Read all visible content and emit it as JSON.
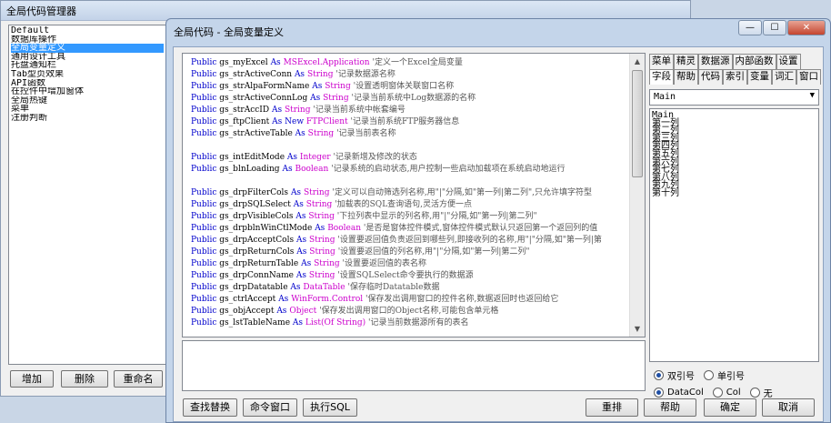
{
  "back_window": {
    "title": "全局代码管理器",
    "list_items": [
      "Default",
      "数据库操作",
      "全局变量定义",
      "通用设计工具",
      "托盘通知栏",
      "Tab型页效果",
      "API函数",
      "在控件中增加窗体",
      "全局热键",
      "菜单",
      "注册判断"
    ],
    "selected_item": "全局变量定义",
    "buttons": {
      "add": "增加",
      "delete": "删除",
      "rename": "重命名"
    }
  },
  "dialog": {
    "title": "全局代码 - 全局变量定义",
    "caption_buttons": {
      "minimize": "—",
      "maximize": "☐",
      "close": "✕"
    },
    "code_lines": [
      {
        "kw": "Public",
        "name": "gs_myExcel",
        "as": "As",
        "type": "MSExcel.Application",
        "comment": "'定义一个Excel全局变量"
      },
      {
        "kw": "Public",
        "name": "gs_strActiveConn",
        "as": "As",
        "type": "String",
        "comment": "'记录数据源名称"
      },
      {
        "kw": "Public",
        "name": "gs_strAlpaFormName",
        "as": "As",
        "type": "String",
        "comment": "'设置透明窗体关联窗口名称"
      },
      {
        "kw": "Public",
        "name": "gs_strActiveConnLog",
        "as": "As",
        "type": "String",
        "comment": "'记录当前系统中Log数据源的名称"
      },
      {
        "kw": "Public",
        "name": "gs_strAccID",
        "as": "As",
        "type": "String",
        "comment": "'记录当前系统中帐套编号"
      },
      {
        "kw": "Public",
        "name": "gs_ftpClient",
        "as": "As New",
        "type": "FTPClient",
        "comment": "'记录当前系统FTP服务器信息"
      },
      {
        "kw": "Public",
        "name": "gs_strActiveTable",
        "as": "As",
        "type": "String",
        "comment": "'记录当前表名称"
      },
      {
        "kw": "",
        "name": "",
        "as": "",
        "type": "",
        "comment": ""
      },
      {
        "kw": "Public",
        "name": "gs_intEditMode",
        "as": "As",
        "type": "Integer",
        "comment": "'记录新增及修改的状态"
      },
      {
        "kw": "Public",
        "name": "gs_blnLoading",
        "as": "As",
        "type": "Boolean",
        "comment": "'记录系统的启动状态,用户控制一些启动加载项在系统启动地运行"
      },
      {
        "kw": "",
        "name": "",
        "as": "",
        "type": "",
        "comment": ""
      },
      {
        "kw": "Public",
        "name": "gs_drpFilterCols",
        "as": "As",
        "type": "String",
        "comment": "'定义可以自动筛选列名称,用\"|\"分隔,如\"第一列|第二列\",只允许填字符型"
      },
      {
        "kw": "Public",
        "name": "gs_drpSQLSelect",
        "as": "As",
        "type": "String",
        "comment": "'加载表的SQL查询语句,灵活方便一点"
      },
      {
        "kw": "Public",
        "name": "gs_drpVisibleCols",
        "as": "As",
        "type": "String",
        "comment": "'下拉列表中显示的列名称,用\"|\"分隔,如\"第一列|第二列\""
      },
      {
        "kw": "Public",
        "name": "gs_drpblnWinCtlMode",
        "as": "As",
        "type": "Boolean",
        "comment": "'是否是窗体控件模式,窗体控件模式默认只返回第一个返回列的值"
      },
      {
        "kw": "Public",
        "name": "gs_drpAcceptCols",
        "as": "As",
        "type": "String",
        "comment": "'设置要返回值负责返回到哪些列,即接收列的名称,用\"|\"分隔,如\"第一列|第"
      },
      {
        "kw": "Public",
        "name": "gs_drpReturnCols",
        "as": "As",
        "type": "String",
        "comment": "'设置要返回值的列名称,用\"|\"分隔,如\"第一列|第二列\""
      },
      {
        "kw": "Public",
        "name": "gs_drpReturnTable",
        "as": "As",
        "type": "String",
        "comment": "'设置要返回值的表名称"
      },
      {
        "kw": "Public",
        "name": "gs_drpConnName",
        "as": "As",
        "type": "String",
        "comment": "'设置SQLSelect命令要执行的数据源"
      },
      {
        "kw": "Public",
        "name": "gs_drpDatatable",
        "as": "As",
        "type": "DataTable",
        "comment": "'保存临时Datatable数据"
      },
      {
        "kw": "Public",
        "name": "gs_ctrlAccept",
        "as": "As",
        "type": "WinForm.Control",
        "comment": "'保存发出调用窗口的控件名称,数据返回时也返回给它"
      },
      {
        "kw": "Public",
        "name": "gs_objAccept",
        "as": "As",
        "type": "Object",
        "comment": "'保存发出调用窗口的Object名称,可能包含单元格"
      },
      {
        "kw": "Public",
        "name": "gs_lstTableName",
        "as": "As",
        "type": "List(Of String)",
        "comment": "'记录当前数据源所有的表名"
      }
    ],
    "tabs_row1": [
      "菜单",
      "精灵",
      "数据源",
      "内部函数",
      "设置"
    ],
    "tabs_row2": [
      "字段",
      "帮助",
      "代码",
      "索引",
      "变量",
      "词汇",
      "窗口"
    ],
    "active_tab": "字段",
    "table_dropdown": "Main",
    "column_list": [
      "Main",
      "第一列",
      "第二列",
      "第三列",
      "第四列",
      "第五列",
      "第六列",
      "第七列",
      "第八列",
      "第九列",
      "第十列"
    ],
    "radio_row1": [
      {
        "label": "双引号",
        "checked": true
      },
      {
        "label": "单引号",
        "checked": false
      }
    ],
    "radio_row2": [
      {
        "label": "DataCol",
        "checked": true
      },
      {
        "label": "Col",
        "checked": false
      },
      {
        "label": "无",
        "checked": false
      }
    ],
    "buttons": {
      "find_replace": "查找替换",
      "command_window": "命令窗口",
      "exec_sql": "执行SQL",
      "reorder": "重排",
      "help": "帮助",
      "ok": "确定",
      "cancel": "取消"
    }
  }
}
